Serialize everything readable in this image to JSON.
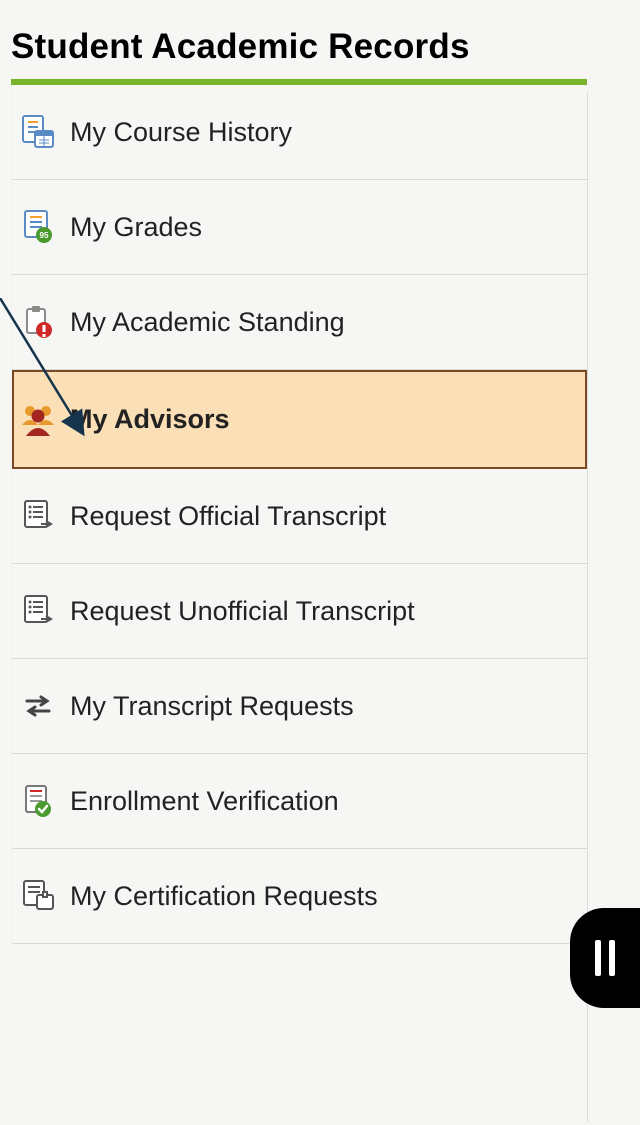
{
  "page_title": "Student Academic Records",
  "menu": {
    "items": [
      {
        "label": "My Course History",
        "icon": "course-history-icon",
        "selected": false
      },
      {
        "label": "My Grades",
        "icon": "grades-icon",
        "selected": false
      },
      {
        "label": "My Academic Standing",
        "icon": "academic-standing-icon",
        "selected": false
      },
      {
        "label": "My Advisors",
        "icon": "advisors-icon",
        "selected": true
      },
      {
        "label": "Request Official Transcript",
        "icon": "transcript-out-icon",
        "selected": false
      },
      {
        "label": "Request Unofficial Transcript",
        "icon": "transcript-out-icon",
        "selected": false
      },
      {
        "label": "My Transcript Requests",
        "icon": "swap-arrows-icon",
        "selected": false
      },
      {
        "label": "Enrollment Verification",
        "icon": "doc-check-icon",
        "selected": false
      },
      {
        "label": "My Certification Requests",
        "icon": "cert-request-icon",
        "selected": false
      }
    ]
  },
  "colors": {
    "accent_green": "#78b42a",
    "selected_bg": "#fadfb7",
    "selected_border": "#7a4a25"
  }
}
